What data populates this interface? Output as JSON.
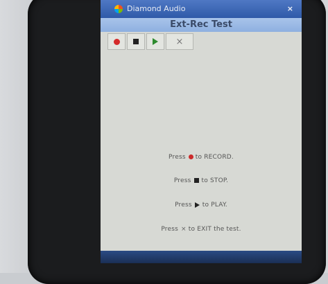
{
  "window": {
    "title": "Diamond Audio",
    "close_symbol": "×"
  },
  "app": {
    "header": "Ext-Rec Test"
  },
  "toolbar": {
    "buttons": [
      {
        "icon": "record-icon"
      },
      {
        "icon": "stop-icon"
      },
      {
        "icon": "play-icon"
      },
      {
        "icon": "exit-icon",
        "symbol": "×"
      }
    ]
  },
  "instructions": {
    "record": {
      "prefix": "Press",
      "suffix": "to RECORD."
    },
    "stop": {
      "prefix": "Press",
      "suffix": "to STOP."
    },
    "play": {
      "prefix": "Press",
      "suffix": "to PLAY."
    },
    "exit": {
      "prefix": "Press",
      "symbol": "×",
      "suffix": "to EXIT the test."
    }
  },
  "colors": {
    "title_bar": "#2f5aa8",
    "header": "#a8c4ea",
    "record": "#d42a2a",
    "play": "#2d8a2d"
  }
}
